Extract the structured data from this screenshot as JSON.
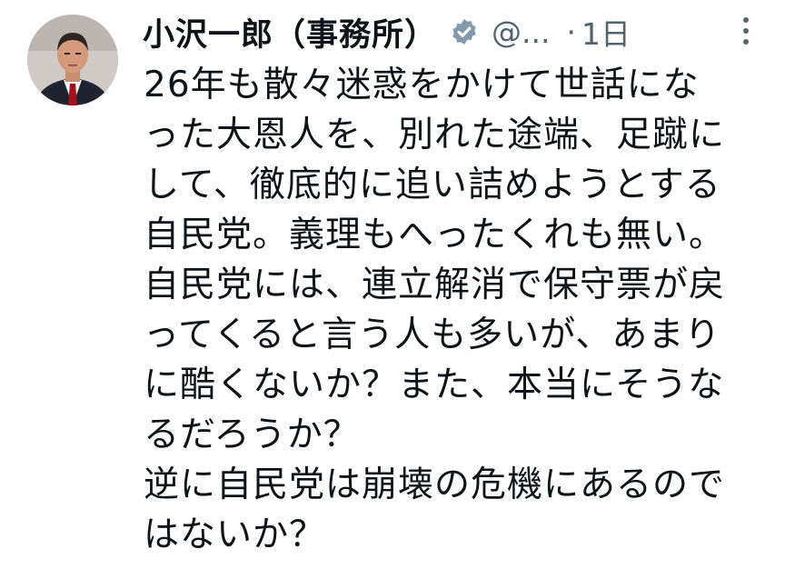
{
  "tweet": {
    "author": {
      "display_name": "小沢一郎（事務所）",
      "handle": "@...",
      "verified_icon": "verified-badge-icon"
    },
    "separator": "·",
    "timestamp": "1日",
    "more_icon": "more-options-icon",
    "text_lines": [
      "26年も散々迷惑をかけて世話にな",
      "った大恩人を、別れた途端、足蹴に",
      "して、徹底的に追い詰めようとする",
      "自民党。義理もへったくれも無い。",
      "自民党には、連立解消で保守票が戻",
      "ってくると言う人も多いが、あまり",
      "に酷くないか？また、本当にそうな",
      "るだろうか？",
      "逆に自民党は崩壊の危機にあるので",
      "はないか？"
    ]
  },
  "colors": {
    "text_primary": "#0f1419",
    "text_secondary": "#536471",
    "verified_badge": "#829aab"
  }
}
